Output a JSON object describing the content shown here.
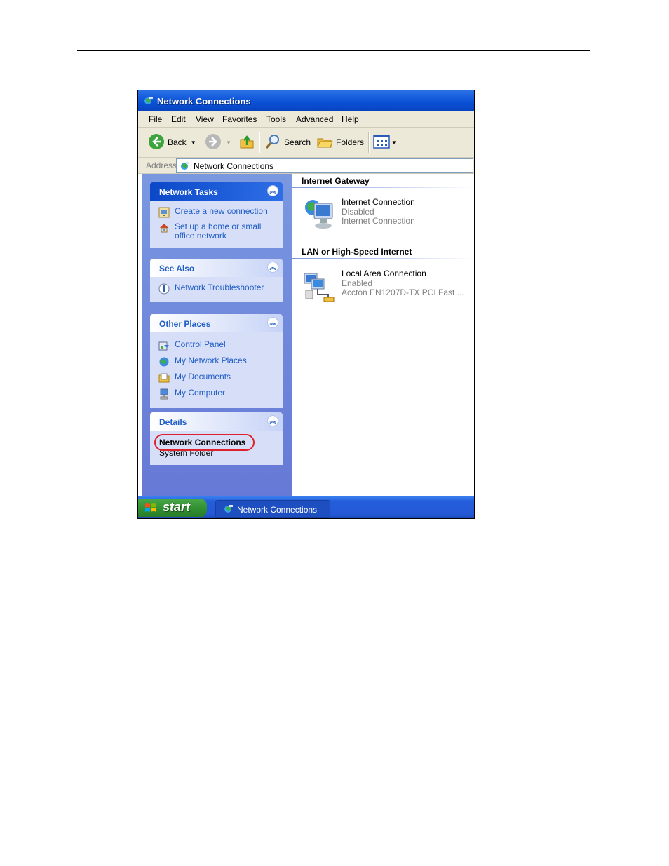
{
  "window": {
    "title": "Network Connections"
  },
  "menu": [
    "File",
    "Edit",
    "View",
    "Favorites",
    "Tools",
    "Advanced",
    "Help"
  ],
  "toolbar": {
    "back_label": "Back",
    "search_label": "Search",
    "folders_label": "Folders"
  },
  "address": {
    "label": "Address",
    "value": "Network Connections"
  },
  "panels": {
    "network_tasks": {
      "title": "Network Tasks",
      "items": [
        "Create a new connection",
        "Set up a home or small office network"
      ]
    },
    "see_also": {
      "title": "See Also",
      "items": [
        "Network Troubleshooter"
      ]
    },
    "other_places": {
      "title": "Other Places",
      "items": [
        "Control Panel",
        "My Network Places",
        "My Documents",
        "My Computer"
      ]
    },
    "details": {
      "title": "Details",
      "name": "Network Connections",
      "type": "System Folder"
    }
  },
  "groups": {
    "internet_gateway": {
      "title": "Internet Gateway",
      "connection": {
        "name": "Internet Connection",
        "status": "Disabled",
        "device": "Internet Connection"
      }
    },
    "lan": {
      "title": "LAN or High-Speed Internet",
      "connection": {
        "name": "Local Area Connection",
        "status": "Enabled",
        "device": "Accton EN1207D-TX PCI Fast ..."
      }
    }
  },
  "taskbar": {
    "start_label": "start",
    "task": "Network Connections"
  },
  "colors": {
    "title_blue": "#0a51d6",
    "link_blue": "#215dc6",
    "highlight_red": "#e0202a"
  }
}
